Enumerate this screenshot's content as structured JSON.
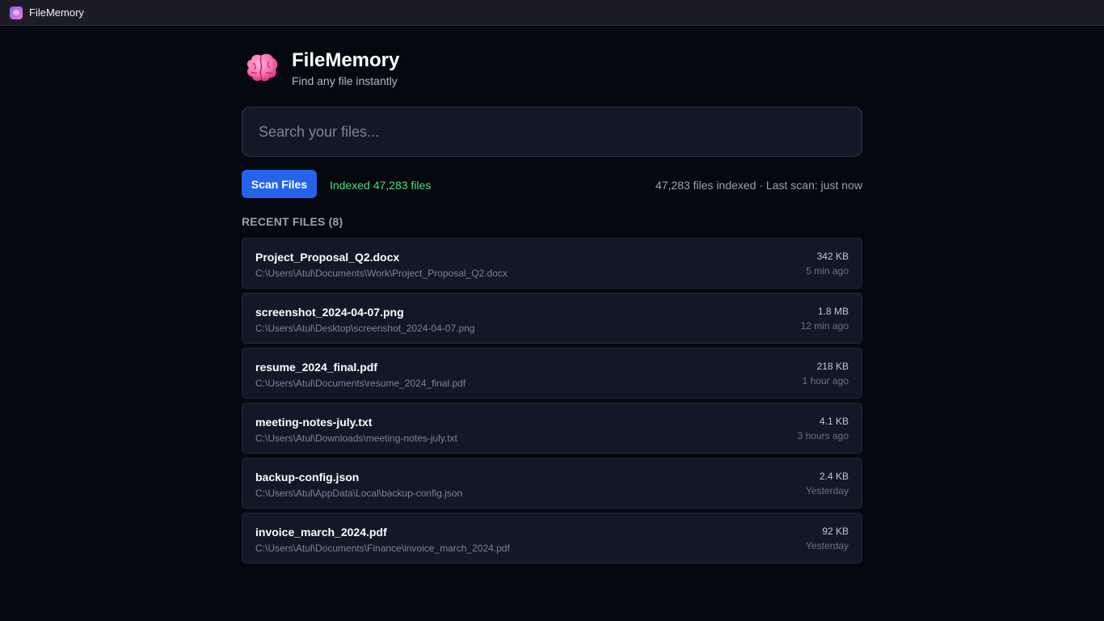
{
  "window": {
    "title": "FileMemory"
  },
  "header": {
    "title": "FileMemory",
    "subtitle": "Find any file instantly",
    "icon": "brain-icon"
  },
  "search": {
    "placeholder": "Search your files...",
    "value": ""
  },
  "actions": {
    "scan_label": "Scan Files",
    "status": "Indexed 47,283 files",
    "index_info": "47,283 files indexed · Last scan: just now"
  },
  "recent": {
    "title": "RECENT FILES (8)",
    "files": [
      {
        "name": "Project_Proposal_Q2.docx",
        "path": "C:\\Users\\Atul\\Documents\\Work\\Project_Proposal_Q2.docx",
        "size": "342 KB",
        "time": "5 min ago"
      },
      {
        "name": "screenshot_2024-04-07.png",
        "path": "C:\\Users\\Atul\\Desktop\\screenshot_2024-04-07.png",
        "size": "1.8 MB",
        "time": "12 min ago"
      },
      {
        "name": "resume_2024_final.pdf",
        "path": "C:\\Users\\Atul\\Documents\\resume_2024_final.pdf",
        "size": "218 KB",
        "time": "1 hour ago"
      },
      {
        "name": "meeting-notes-july.txt",
        "path": "C:\\Users\\Atul\\Downloads\\meeting-notes-july.txt",
        "size": "4.1 KB",
        "time": "3 hours ago"
      },
      {
        "name": "backup-config.json",
        "path": "C:\\Users\\Atul\\AppData\\Local\\backup-config.json",
        "size": "2.4 KB",
        "time": "Yesterday"
      },
      {
        "name": "invoice_march_2024.pdf",
        "path": "C:\\Users\\Atul\\Documents\\Finance\\invoice_march_2024.pdf",
        "size": "92 KB",
        "time": "Yesterday"
      }
    ]
  },
  "colors": {
    "accent": "#2563eb",
    "status": "#4ade80",
    "background": "#05080f",
    "card": "#111827"
  }
}
